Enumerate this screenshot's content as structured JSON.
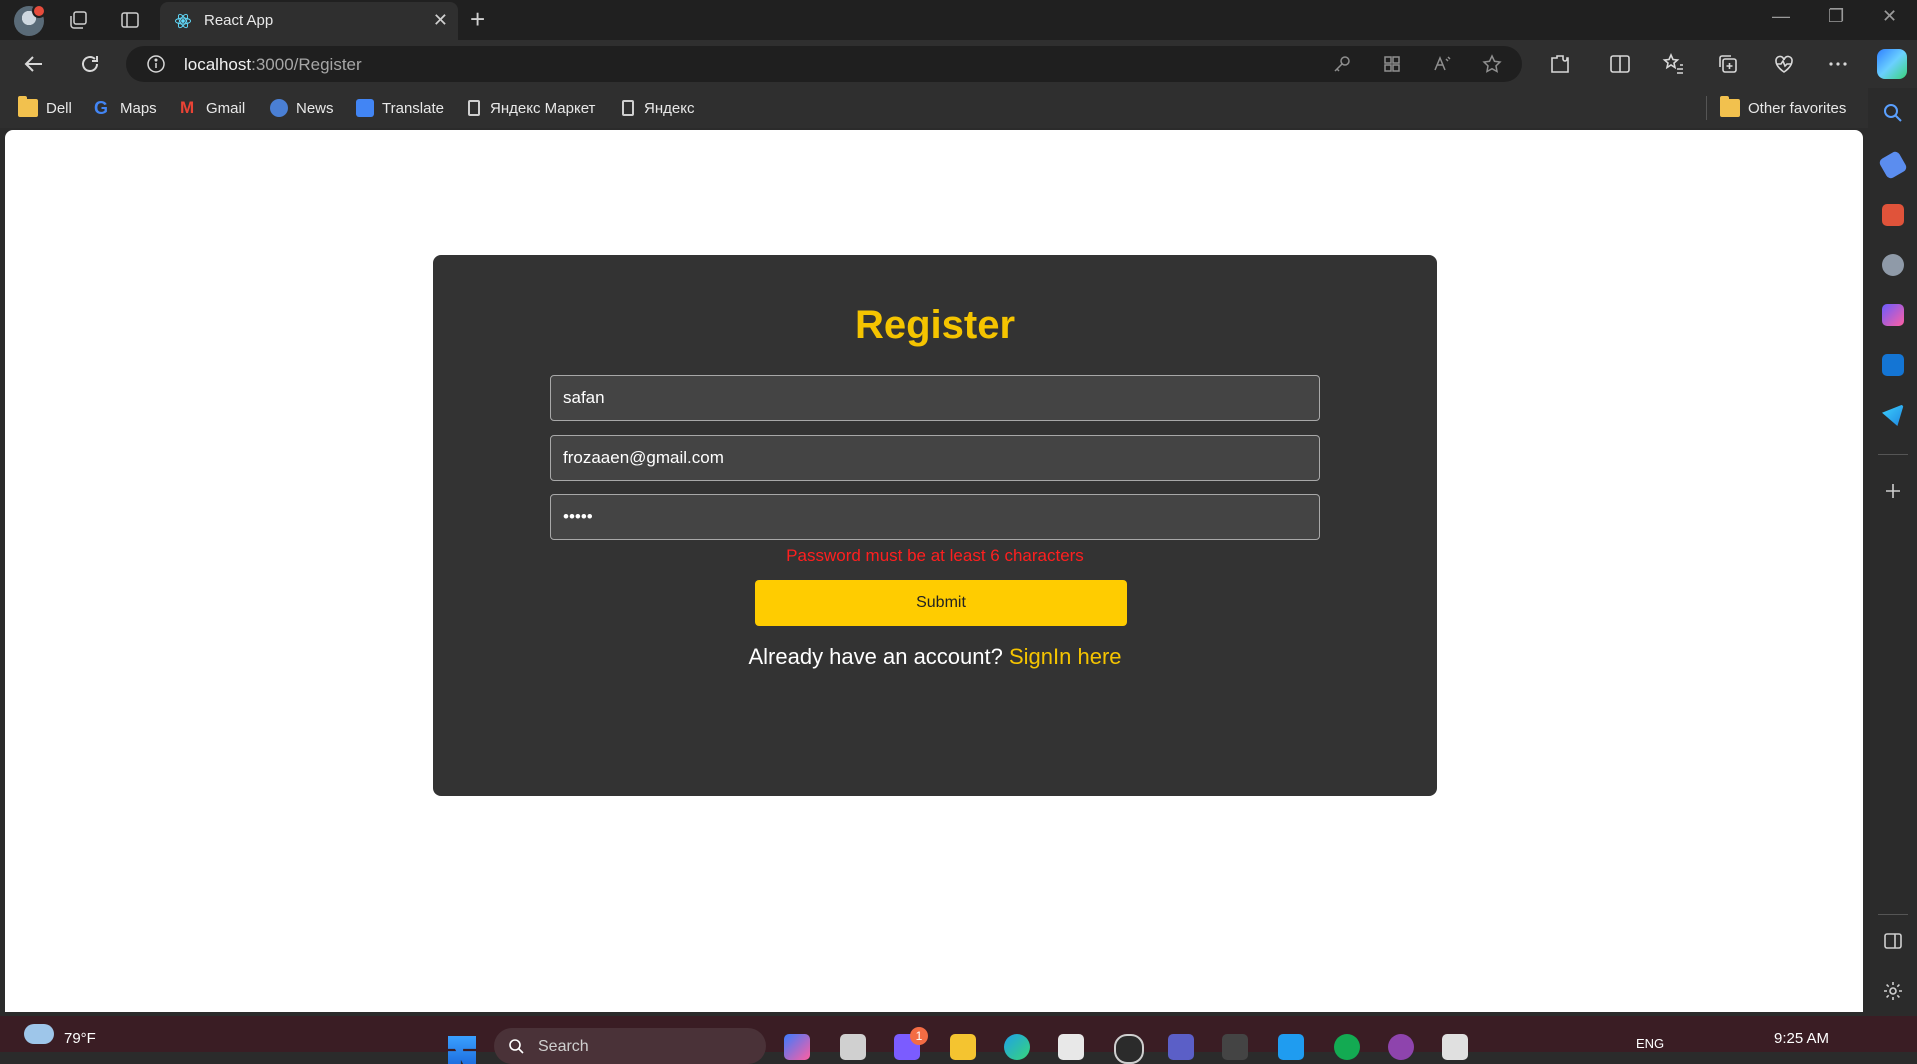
{
  "browser": {
    "tab_title": "React App",
    "url_host": "localhost",
    "url_path": ":3000/Register",
    "favorites": [
      {
        "label": "Dell",
        "icon": "folder-icon"
      },
      {
        "label": "Maps",
        "icon": "google-icon"
      },
      {
        "label": "Gmail",
        "icon": "gmail-icon"
      },
      {
        "label": "News",
        "icon": "news-icon"
      },
      {
        "label": "Translate",
        "icon": "translate-icon"
      },
      {
        "label": "Яндекс Маркет",
        "icon": "page-icon"
      },
      {
        "label": "Яндекс",
        "icon": "page-icon"
      }
    ],
    "other_favorites": "Other favorites"
  },
  "page": {
    "title": "Register",
    "fields": {
      "username": "safan",
      "email": "frozaaen@gmail.com",
      "password": "•••••"
    },
    "error": "Password must be at least 6 characters",
    "submit_label": "Submit",
    "signin_prompt": "Already have an account? ",
    "signin_link": "SignIn here"
  },
  "taskbar": {
    "temperature": "79°F",
    "search_placeholder": "Search",
    "notification_count": "1",
    "language": "ENG",
    "time": "9:25 AM"
  },
  "colors": {
    "accent": "#f5c400",
    "button": "#ffcc00",
    "error": "#ff1f1f",
    "card": "#333333"
  }
}
